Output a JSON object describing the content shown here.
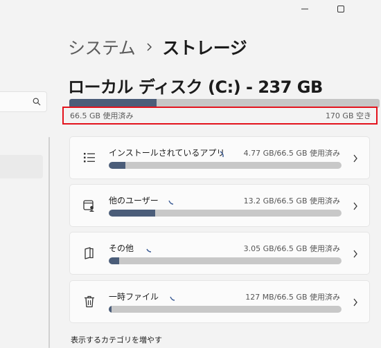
{
  "breadcrumb": {
    "parent": "システム",
    "current": "ストレージ"
  },
  "disk": {
    "title": "ローカル ディスク (C:) - 237 GB",
    "used_label": "66.5 GB 使用済み",
    "free_label": "170 GB 空き",
    "used_fraction": 0.281
  },
  "search": {
    "value": "",
    "placeholder": ""
  },
  "categories": [
    {
      "name": "インストールされているアプリ",
      "size": "4.77 GB/66.5 GB 使用済み",
      "fraction": 0.072,
      "icon": "apps-list-icon"
    },
    {
      "name": "他のユーザー",
      "size": "13.2 GB/66.5 GB 使用済み",
      "fraction": 0.199,
      "icon": "other-users-icon"
    },
    {
      "name": "その他",
      "size": "3.05 GB/66.5 GB 使用済み",
      "fraction": 0.046,
      "icon": "other-files-icon"
    },
    {
      "name": "一時ファイル",
      "size": "127 MB/66.5 GB 使用済み",
      "fraction": 0.002,
      "icon": "trash-icon"
    }
  ],
  "more_link": "表示するカテゴリを増やす",
  "colors": {
    "bar_fill": "#4b5d79",
    "bar_track": "#c8c8c8",
    "highlight": "#e3121c",
    "background": "#f3f3f3",
    "card": "#fbfbfb"
  }
}
